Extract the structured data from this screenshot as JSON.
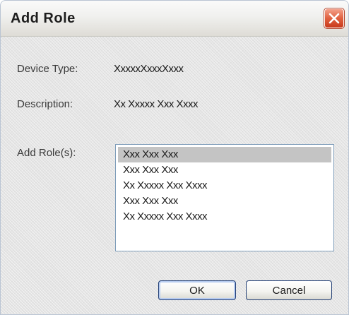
{
  "dialog": {
    "title": "Add Role",
    "close_icon": "close-icon"
  },
  "fields": {
    "device_type_label": "Device Type:",
    "device_type_value": "XxxxxXxxxXxxx",
    "description_label": "Description:",
    "description_value": "Xx Xxxxx Xxx Xxxx",
    "add_roles_label": "Add Role(s):"
  },
  "roles_list": {
    "items": [
      {
        "label": "Xxx Xxx Xxx",
        "selected": true
      },
      {
        "label": "Xxx Xxx Xxx",
        "selected": false
      },
      {
        "label": "Xx Xxxxx Xxx Xxxx",
        "selected": false
      },
      {
        "label": "Xxx Xxx Xxx",
        "selected": false
      },
      {
        "label": "Xx Xxxxx Xxx Xxxx",
        "selected": false
      }
    ]
  },
  "buttons": {
    "ok_label": "OK",
    "cancel_label": "Cancel"
  },
  "colors": {
    "close_button": "#d9502e",
    "selection": "#c4c4c4",
    "button_border": "#1f3c73"
  }
}
